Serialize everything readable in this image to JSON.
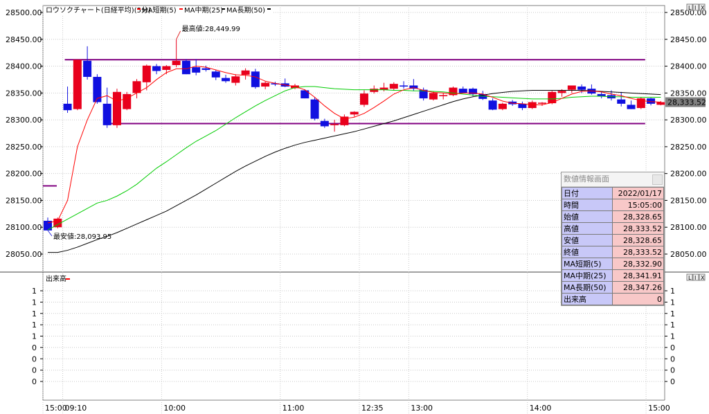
{
  "chart_data": [
    {
      "type": "candlestick",
      "title": "ロウソクチャート(日経平均)(5分)",
      "legend": [
        {
          "name": "MA短期(5)",
          "color": "#ff0000"
        },
        {
          "name": "MA中期(25)",
          "color": "#ff0000"
        },
        {
          "name": "MA長期(50)",
          "color": "#000000"
        }
      ],
      "ylim": [
        28030,
        28510
      ],
      "y_ticks": [
        "28500.00",
        "28450.00",
        "28400.00",
        "28350.00",
        "28300.00",
        "28250.00",
        "28200.00",
        "28150.00",
        "28100.00",
        "28050.00"
      ],
      "y_tick_values": [
        28500,
        28450,
        28400,
        28350,
        28300,
        28250,
        28200,
        28150,
        28100,
        28050
      ],
      "x_ticks": [
        {
          "label": "15:00",
          "index": 0
        },
        {
          "label": "09:10",
          "index": 2
        },
        {
          "label": "10:00",
          "index": 12
        },
        {
          "label": "11:00",
          "index": 24
        },
        {
          "label": "12:35",
          "index": 32
        },
        {
          "label": "13:00",
          "index": 37
        },
        {
          "label": "14:00",
          "index": 49
        },
        {
          "label": "15:00",
          "index": 61
        }
      ],
      "candles": [
        {
          "o": 28112,
          "h": 28118,
          "l": 28096,
          "c": 28094
        },
        {
          "o": 28100,
          "h": 28118,
          "l": 28098,
          "c": 28116
        },
        {
          "o": 28330,
          "h": 28362,
          "l": 28313,
          "c": 28318
        },
        {
          "o": 28320,
          "h": 28412,
          "l": 28318,
          "c": 28412
        },
        {
          "o": 28410,
          "h": 28437,
          "l": 28375,
          "c": 28380
        },
        {
          "o": 28380,
          "h": 28385,
          "l": 28330,
          "c": 28333
        },
        {
          "o": 28330,
          "h": 28360,
          "l": 28285,
          "c": 28290
        },
        {
          "o": 28290,
          "h": 28358,
          "l": 28285,
          "c": 28352
        },
        {
          "o": 28320,
          "h": 28352,
          "l": 28318,
          "c": 28348
        },
        {
          "o": 28350,
          "h": 28376,
          "l": 28340,
          "c": 28372
        },
        {
          "o": 28370,
          "h": 28403,
          "l": 28355,
          "c": 28401
        },
        {
          "o": 28400,
          "h": 28404,
          "l": 28385,
          "c": 28391
        },
        {
          "o": 28393,
          "h": 28402,
          "l": 28385,
          "c": 28400
        },
        {
          "o": 28402,
          "h": 28450,
          "l": 28398,
          "c": 28410
        },
        {
          "o": 28410,
          "h": 28413,
          "l": 28385,
          "c": 28385
        },
        {
          "o": 28398,
          "h": 28413,
          "l": 28383,
          "c": 28388
        },
        {
          "o": 28396,
          "h": 28401,
          "l": 28390,
          "c": 28393
        },
        {
          "o": 28390,
          "h": 28393,
          "l": 28374,
          "c": 28379
        },
        {
          "o": 28378,
          "h": 28384,
          "l": 28369,
          "c": 28372
        },
        {
          "o": 28369,
          "h": 28385,
          "l": 28364,
          "c": 28381
        },
        {
          "o": 28384,
          "h": 28396,
          "l": 28375,
          "c": 28392
        },
        {
          "o": 28390,
          "h": 28395,
          "l": 28358,
          "c": 28361
        },
        {
          "o": 28362,
          "h": 28371,
          "l": 28357,
          "c": 28369
        },
        {
          "o": 28368,
          "h": 28371,
          "l": 28363,
          "c": 28366
        },
        {
          "o": 28368,
          "h": 28377,
          "l": 28361,
          "c": 28362
        },
        {
          "o": 28359,
          "h": 28367,
          "l": 28357,
          "c": 28364
        },
        {
          "o": 28355,
          "h": 28357,
          "l": 28340,
          "c": 28340
        },
        {
          "o": 28338,
          "h": 28342,
          "l": 28299,
          "c": 28302
        },
        {
          "o": 28298,
          "h": 28302,
          "l": 28285,
          "c": 28288
        },
        {
          "o": 28290,
          "h": 28300,
          "l": 28278,
          "c": 28292
        },
        {
          "o": 28290,
          "h": 28310,
          "l": 28288,
          "c": 28306
        },
        {
          "o": 28310,
          "h": 28316,
          "l": 28306,
          "c": 28315
        },
        {
          "o": 28328,
          "h": 28355,
          "l": 28324,
          "c": 28349
        },
        {
          "o": 28352,
          "h": 28364,
          "l": 28349,
          "c": 28358
        },
        {
          "o": 28356,
          "h": 28369,
          "l": 28353,
          "c": 28360
        },
        {
          "o": 28358,
          "h": 28370,
          "l": 28355,
          "c": 28367
        },
        {
          "o": 28364,
          "h": 28372,
          "l": 28358,
          "c": 28362
        },
        {
          "o": 28364,
          "h": 28376,
          "l": 28354,
          "c": 28358
        },
        {
          "o": 28356,
          "h": 28360,
          "l": 28336,
          "c": 28340
        },
        {
          "o": 28338,
          "h": 28353,
          "l": 28336,
          "c": 28350
        },
        {
          "o": 28344,
          "h": 28350,
          "l": 28338,
          "c": 28346
        },
        {
          "o": 28346,
          "h": 28362,
          "l": 28344,
          "c": 28360
        },
        {
          "o": 28358,
          "h": 28362,
          "l": 28350,
          "c": 28350
        },
        {
          "o": 28358,
          "h": 28360,
          "l": 28344,
          "c": 28348
        },
        {
          "o": 28348,
          "h": 28354,
          "l": 28337,
          "c": 28339
        },
        {
          "o": 28336,
          "h": 28340,
          "l": 28318,
          "c": 28319
        },
        {
          "o": 28320,
          "h": 28332,
          "l": 28318,
          "c": 28330
        },
        {
          "o": 28334,
          "h": 28337,
          "l": 28326,
          "c": 28329
        },
        {
          "o": 28330,
          "h": 28334,
          "l": 28318,
          "c": 28322
        },
        {
          "o": 28322,
          "h": 28336,
          "l": 28320,
          "c": 28333
        },
        {
          "o": 28330,
          "h": 28333,
          "l": 28326,
          "c": 28332
        },
        {
          "o": 28331,
          "h": 28354,
          "l": 28329,
          "c": 28352
        },
        {
          "o": 28350,
          "h": 28357,
          "l": 28343,
          "c": 28354
        },
        {
          "o": 28356,
          "h": 28364,
          "l": 28350,
          "c": 28364
        },
        {
          "o": 28362,
          "h": 28366,
          "l": 28350,
          "c": 28356
        },
        {
          "o": 28358,
          "h": 28366,
          "l": 28347,
          "c": 28349
        },
        {
          "o": 28348,
          "h": 28353,
          "l": 28340,
          "c": 28344
        },
        {
          "o": 28346,
          "h": 28355,
          "l": 28336,
          "c": 28340
        },
        {
          "o": 28338,
          "h": 28352,
          "l": 28325,
          "c": 28330
        },
        {
          "o": 28328,
          "h": 28336,
          "l": 28320,
          "c": 28320
        },
        {
          "o": 28322,
          "h": 28342,
          "l": 28320,
          "c": 28340
        },
        {
          "o": 28340,
          "h": 28341,
          "l": 28327,
          "c": 28330
        },
        {
          "o": 28328,
          "h": 28335,
          "l": 28327,
          "c": 28333
        }
      ],
      "ma_short": [
        28108,
        28112,
        28150,
        28250,
        28300,
        28340,
        28345,
        28335,
        28340,
        28350,
        28360,
        28375,
        28388,
        28395,
        28395,
        28400,
        28398,
        28393,
        28388,
        28384,
        28383,
        28380,
        28372,
        28368,
        28365,
        28362,
        28356,
        28342,
        28326,
        28312,
        28302,
        28305,
        28312,
        28323,
        28335,
        28348,
        28356,
        28360,
        28355,
        28351,
        28350,
        28348,
        28350,
        28350,
        28348,
        28342,
        28335,
        28331,
        28330,
        28328,
        28328,
        28332,
        28340,
        28348,
        28353,
        28354,
        28352,
        28348,
        28345,
        28340,
        28336,
        28334,
        28333
      ],
      "ma_mid": [
        28095,
        28105,
        28115,
        28125,
        28135,
        28145,
        28150,
        28158,
        28168,
        28180,
        28195,
        28210,
        28222,
        28235,
        28248,
        28260,
        28270,
        28280,
        28292,
        28304,
        28315,
        28326,
        28336,
        28345,
        28354,
        28360,
        28362,
        28362,
        28360,
        28358,
        28357,
        28356,
        28356,
        28356,
        28356,
        28355,
        28355,
        28354,
        28354,
        28353,
        28352,
        28350,
        28348,
        28346,
        28344,
        28343,
        28342,
        28341,
        28340,
        28339,
        28339,
        28339,
        28340,
        28342,
        28343,
        28344,
        28344,
        28343,
        28343,
        28342,
        28342,
        28342,
        28342
      ],
      "ma_long": [
        28053,
        28053,
        28057,
        28063,
        28070,
        28077,
        28083,
        28090,
        28098,
        28106,
        28114,
        28122,
        28130,
        28140,
        28150,
        28160,
        28171,
        28182,
        28193,
        28204,
        28214,
        28223,
        28232,
        28240,
        28247,
        28253,
        28258,
        28262,
        28266,
        28270,
        28274,
        28278,
        28283,
        28288,
        28293,
        28298,
        28304,
        28310,
        28316,
        28322,
        28328,
        28334,
        28339,
        28343,
        28346,
        28349,
        28351,
        28353,
        28354,
        28355,
        28355,
        28355,
        28355,
        28355,
        28355,
        28354,
        28353,
        28352,
        28351,
        28350,
        28349,
        28348,
        28347
      ],
      "hlines": [
        {
          "value": 28412,
          "from": 2,
          "to": 60
        },
        {
          "value": 28293,
          "from": 6,
          "to": 60
        }
      ],
      "stub_line": {
        "value": 28177
      },
      "annotations": [
        {
          "text": "最高値:28,449.99",
          "index": 13,
          "value": 28450,
          "color": "#e03030"
        },
        {
          "text": "最安値:28,093.95",
          "index": 0,
          "value": 28094,
          "color": "#3030e0"
        }
      ],
      "last_price": "28,333.52"
    },
    {
      "type": "bar",
      "title": "出来高",
      "ylim": [
        -0.2,
        1.2
      ],
      "y_ticks": [
        "1",
        "1",
        "1",
        "1",
        "1",
        "0",
        "0",
        "0",
        "0"
      ],
      "y_tick_values": [
        1.0,
        0.875,
        0.75,
        0.625,
        0.5,
        0.375,
        0.25,
        0.125,
        0.0
      ],
      "values": []
    }
  ],
  "info_panel": {
    "title": "数値情報画面",
    "rows": [
      {
        "label": "日付",
        "value": "2022/01/17"
      },
      {
        "label": "時間",
        "value": "15:05:00"
      },
      {
        "label": "始値",
        "value": "28,328.65"
      },
      {
        "label": "高値",
        "value": "28,333.52"
      },
      {
        "label": "安値",
        "value": "28,328.65"
      },
      {
        "label": "終値",
        "value": "28,333.52"
      },
      {
        "label": "MA短期(5)",
        "value": "28,332.90"
      },
      {
        "label": "MA中期(25)",
        "value": "28,341.91"
      },
      {
        "label": "MA長期(50)",
        "value": "28,347.26"
      },
      {
        "label": "出来高",
        "value": "0"
      }
    ]
  },
  "pane_buttons": [
    "L",
    "I",
    "X"
  ],
  "colors": {
    "up": "#e8001c",
    "down": "#1010e0",
    "ma_short": "#ff0000",
    "ma_mid": "#00cc00",
    "ma_long": "#000000",
    "hline": "#800080",
    "grid": "#c8c8c8"
  }
}
